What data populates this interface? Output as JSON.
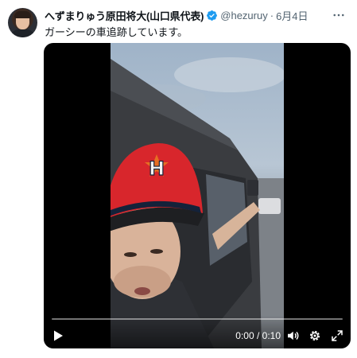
{
  "post": {
    "display_name": "へずまりゅう原田将大(山口県代表)",
    "handle": "@hezuruy",
    "separator": "·",
    "date": "6月4日",
    "text": "ガーシーの車追跡しています。"
  },
  "video": {
    "elapsed": "0:00",
    "duration": "0:10",
    "time_separator": " / ",
    "progress_percent": 0,
    "cap_letter": "H"
  },
  "icons": {
    "avatar": "profile-photo",
    "verified": "verified-badge-icon",
    "more": "more-options-icon",
    "play": "play-icon",
    "volume": "volume-icon",
    "settings": "gear-icon",
    "fullscreen": "fullscreen-icon"
  },
  "colors": {
    "verified_blue": "#1d9bf0",
    "secondary_text": "#536471",
    "primary_text": "#0f1419",
    "cap_red": "#d8262c"
  }
}
